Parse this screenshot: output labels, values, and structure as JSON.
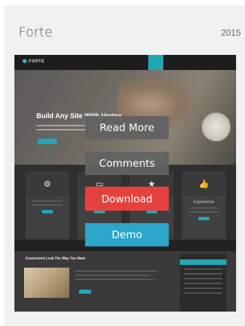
{
  "card": {
    "title": "Forte",
    "year": "2015"
  },
  "preview": {
    "logo": "FORTE",
    "hero_title": "Build Any Site With Vertex",
    "features": [
      {
        "icon": "⚙",
        "label": ""
      },
      {
        "icon": "▭",
        "label": ""
      },
      {
        "icon": "★",
        "label": ""
      },
      {
        "icon": "👍",
        "label": "Experience"
      }
    ],
    "post_title": "Customized Look The Way You Want"
  },
  "actions": {
    "read_more": "Read More",
    "comments": "Comments",
    "download": "Download",
    "demo": "Demo"
  },
  "colors": {
    "download": "#e5413f",
    "demo": "#2ba5c9",
    "accent": "#23a6b4"
  }
}
